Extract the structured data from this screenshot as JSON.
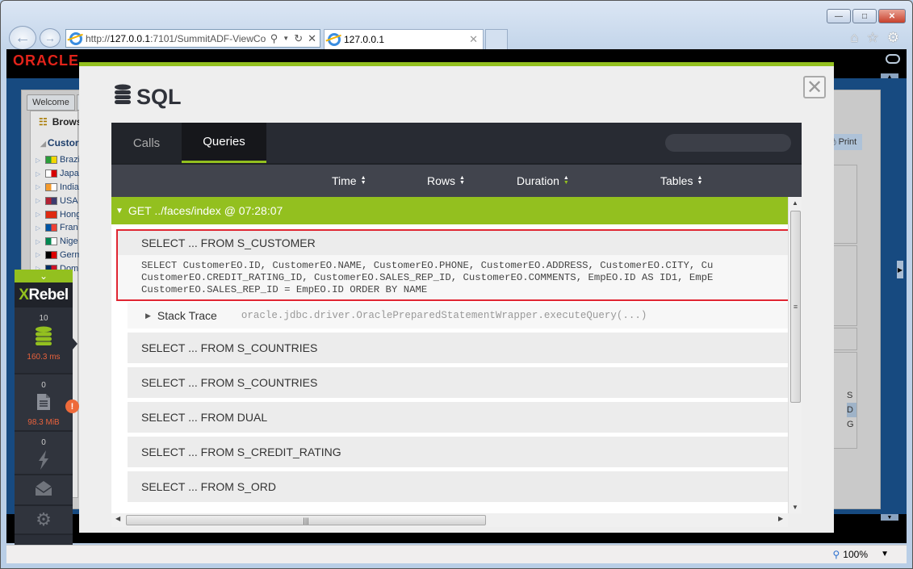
{
  "browser": {
    "address": {
      "prefix": "http://",
      "host": "127.0.0.1",
      "rest": ":7101/SummitADF-ViewCo"
    },
    "tab_title": "127.0.0.1",
    "window_controls": {
      "minimize": "—",
      "maximize": "□",
      "close": "✕"
    },
    "tools": {
      "home": "⌂",
      "favorites": "☆",
      "settings": "⚙"
    },
    "zoom_level": "100%"
  },
  "oracle_app": {
    "logo": "ORACLE",
    "welcome_tab": "Welcome",
    "browse_title": "Brows",
    "customers_title": "Custor",
    "countries": [
      {
        "name": "Brazi",
        "colors": [
          "#2a9d3a",
          "#f2d600"
        ]
      },
      {
        "name": "Japa",
        "colors": [
          "#ffffff",
          "#d60000"
        ]
      },
      {
        "name": "India",
        "colors": [
          "#f39a2b",
          "#ffffff"
        ]
      },
      {
        "name": "USA",
        "colors": [
          "#b22234",
          "#3c3b6e"
        ]
      },
      {
        "name": "Hong",
        "colors": [
          "#de2910",
          "#de2910"
        ]
      },
      {
        "name": "Fran",
        "colors": [
          "#0055a4",
          "#ef4135"
        ]
      },
      {
        "name": "Nige",
        "colors": [
          "#008751",
          "#ffffff"
        ]
      },
      {
        "name": "Germ",
        "colors": [
          "#000000",
          "#dd0000"
        ]
      },
      {
        "name": "Dom",
        "colors": [
          "#002d62",
          "#ce1126"
        ]
      }
    ],
    "print_button": "Print",
    "grid_letters": [
      "S",
      "D",
      "G"
    ]
  },
  "xrebel": {
    "logo_x": "X",
    "logo_rest": "Rebel",
    "sections": [
      {
        "name": "sql",
        "count": "10",
        "metric": "160.3 ms"
      },
      {
        "name": "io",
        "count": "0",
        "metric": "98.3 MiB",
        "alert": "!"
      },
      {
        "name": "exceptions",
        "count": "0"
      },
      {
        "name": "messages"
      },
      {
        "name": "settings"
      }
    ]
  },
  "modal": {
    "title": "SQL",
    "close": "✕",
    "tabs": [
      {
        "label": "Calls",
        "active": false
      },
      {
        "label": "Queries",
        "active": true
      }
    ],
    "search": {
      "value": "",
      "placeholder": ""
    },
    "columns": [
      {
        "label": "Time",
        "sort_active": false
      },
      {
        "label": "Rows",
        "sort_active": false
      },
      {
        "label": "Duration",
        "sort_active": true
      },
      {
        "label": "Tables",
        "sort_active": false
      }
    ],
    "group": {
      "label": "GET ../faces/index @ 07:28:07"
    },
    "expanded_query": {
      "title": "SELECT ... FROM S_CUSTOMER",
      "sql_lines": [
        "SELECT CustomerEO.ID, CustomerEO.NAME, CustomerEO.PHONE, CustomerEO.ADDRESS, CustomerEO.CITY, Cu",
        "CustomerEO.CREDIT_RATING_ID, CustomerEO.SALES_REP_ID, CustomerEO.COMMENTS, EmpEO.ID AS ID1, EmpE",
        "CustomerEO.SALES_REP_ID = EmpEO.ID ORDER BY NAME"
      ],
      "stack_label": "Stack Trace",
      "stack_trace": "oracle.jdbc.driver.OraclePreparedStatementWrapper.executeQuery(...)"
    },
    "queries": [
      "SELECT ... FROM S_COUNTRIES",
      "SELECT ... FROM S_COUNTRIES",
      "SELECT ... FROM DUAL",
      "SELECT ... FROM S_CREDIT_RATING",
      "SELECT ... FROM S_ORD"
    ]
  },
  "colors": {
    "accent_green": "#93c01f",
    "highlight_red": "#e02632",
    "metric_orange": "#e8613c",
    "oracle_red": "#e2231a"
  }
}
